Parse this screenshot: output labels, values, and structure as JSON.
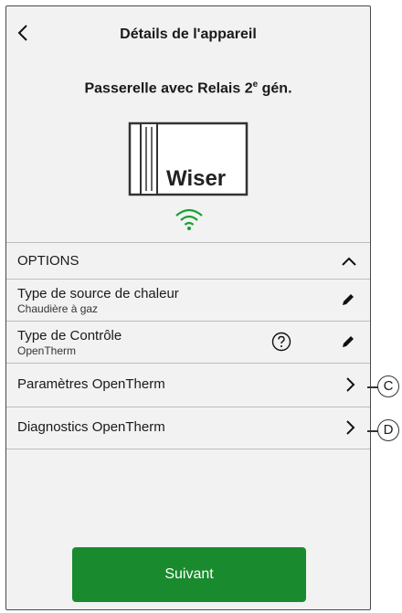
{
  "header": {
    "title": "Détails de l'appareil"
  },
  "device": {
    "name": "Passerelle avec Relais 2",
    "name_sup": "e",
    "name_suffix": " gén.",
    "logo_text": "Wiser"
  },
  "options": {
    "label": "OPTIONS"
  },
  "rows": [
    {
      "main": "Type de source de chaleur",
      "sub": "Chaudière à gaz"
    },
    {
      "main": "Type de Contrôle",
      "sub": "OpenTherm"
    },
    {
      "main": "Paramètres OpenTherm",
      "callout": "C"
    },
    {
      "main": "Diagnostics OpenTherm",
      "callout": "D"
    }
  ],
  "footer": {
    "button_label": "Suivant"
  },
  "colors": {
    "accent_green": "#1a8a2e",
    "wifi_green": "#1aa031"
  }
}
